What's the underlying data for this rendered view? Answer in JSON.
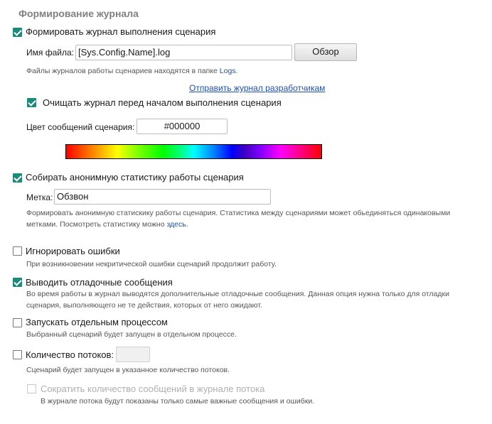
{
  "section": {
    "title": "Формирование журнала"
  },
  "log": {
    "enable_label": "Формировать журнал выполнения сценария",
    "enable_checked": true,
    "file_label": "Имя файла:",
    "file_value": "[Sys.Config.Name].log",
    "browse_button": "Обзор",
    "hint_prefix": "Файлы журналов работы сценариев находятся в папке ",
    "hint_link": "Logs",
    "hint_suffix": ".",
    "send_link": "Отправить журнал разработчикам",
    "clear_label": "Очищать журнал перед началом выполнения сценария",
    "clear_checked": true,
    "color_label": "Цвет сообщений сценария:",
    "color_value": "#000000"
  },
  "stats": {
    "enable_label": "Собирать анонимную статистику работы сценария",
    "enable_checked": true,
    "tag_label": "Метка:",
    "tag_value": "Обзвон",
    "hint_line1": "Формировать анонимную статискику работы сценария. Статистика между сценариями может обьединяться одинаковыми",
    "hint_line2_prefix": "метками. Посмотреть статистику можно ",
    "hint_link": "здесь",
    "hint_line2_suffix": "."
  },
  "ignore_errors": {
    "label": "Игнорировать ошибки",
    "checked": false,
    "hint": "При возникновении некритической ошибки сценарий продолжит работу."
  },
  "debug": {
    "label": "Выводить отладочные сообщения",
    "checked": true,
    "hint_line1": "Во время работы в журнал выводятся дополнительные отладочные сообщения. Данная опция нужна только для отладки",
    "hint_line2": "сценария, выполняющего не те действия, которых от него ожидают."
  },
  "separate_process": {
    "label": "Запускать отдельным процессом",
    "checked": false,
    "hint": "Выбранный сценарий будет запущен в отдельном процессе."
  },
  "threads": {
    "label": "Количество потоков:",
    "checked": false,
    "value": "",
    "hint": "Сценарий будет запущен в указанное количество потоков."
  },
  "reduce_messages": {
    "label": "Сократить количество сообщений в журнале потока",
    "checked": false,
    "disabled": true,
    "hint": "В журнале потока будут показаны только самые важные сообщения и ошибки."
  },
  "colors": {
    "accent": "#1f8a7a",
    "link": "#1f4fb6",
    "title": "#808080"
  }
}
